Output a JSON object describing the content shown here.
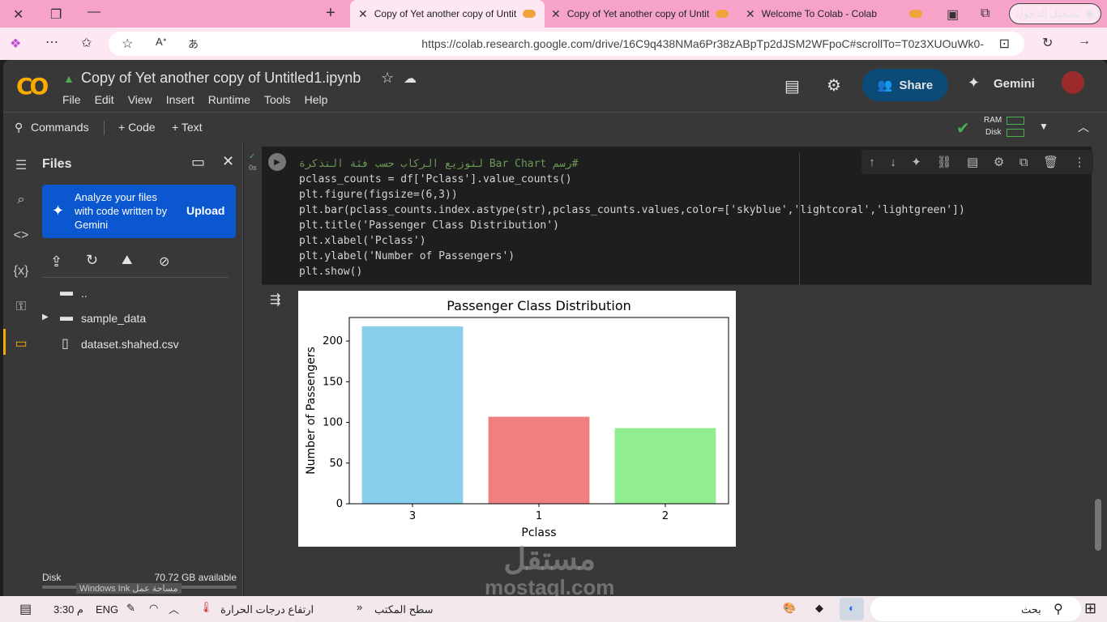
{
  "browser": {
    "tabs": [
      {
        "title": "Copy of Yet another copy of Untit"
      },
      {
        "title": "Copy of Yet another copy of Untit"
      },
      {
        "title": "Welcome To Colab - Colab"
      }
    ],
    "signin_label": "تسجيل الدخول",
    "url": "https://colab.research.google.com/drive/16C9q438NMa6Pr38zABpTp2dJSM2WFpoC#scrollTo=T0z3XUOuWk0-"
  },
  "colab": {
    "logo": "CO",
    "notebook_title": "Copy of Yet another copy of Untitled1.ipynb",
    "menus": [
      "File",
      "Edit",
      "View",
      "Insert",
      "Runtime",
      "Tools",
      "Help"
    ],
    "share_label": "Share",
    "gemini_label": "Gemini",
    "toolbar": {
      "commands": "Commands",
      "code": "+ Code",
      "text": "+ Text",
      "ram": "RAM",
      "disk": "Disk"
    }
  },
  "files_panel": {
    "title": "Files",
    "gemini_promo": "Analyze your files with code written by Gemini",
    "upload_label": "Upload",
    "items": [
      "..",
      "sample_data",
      "dataset.shahed.csv"
    ],
    "disk_label": "Disk",
    "disk_available": "70.72 GB available"
  },
  "cell": {
    "exec_time": "0s",
    "code_lines": [
      "#رسم Bar Chart لتوزيع الركاب حسب فئة التذكرة",
      "pclass_counts = df['Pclass'].value_counts()",
      "plt.figure(figsize=(6,3))",
      "plt.bar(pclass_counts.index.astype(str),pclass_counts.values,color=['skyblue','lightcoral','lightgreen'])",
      "plt.title('Passenger Class Distribution')",
      "plt.xlabel('Pclass')",
      "plt.ylabel('Number of Passengers')",
      "plt.show()"
    ]
  },
  "chart_data": {
    "type": "bar",
    "title": "Passenger Class Distribution",
    "xlabel": "Pclass",
    "ylabel": "Number of Passengers",
    "categories": [
      "3",
      "1",
      "2"
    ],
    "values": [
      218,
      107,
      93
    ],
    "colors": [
      "#87ceeb",
      "#f08080",
      "#90ee90"
    ],
    "ylim": [
      0,
      229
    ],
    "yticks": [
      0,
      50,
      100,
      150,
      200
    ]
  },
  "taskbar": {
    "time": "3:30 م",
    "lang": "ENG",
    "weather": "ارتفاع درجات الحرارة",
    "desktop": "سطح المكتب",
    "search": "بحث",
    "ink_label": "Windows Ink مساحة عمل"
  },
  "watermark": {
    "line1": "مستقل",
    "line2": "mostaql.com"
  }
}
